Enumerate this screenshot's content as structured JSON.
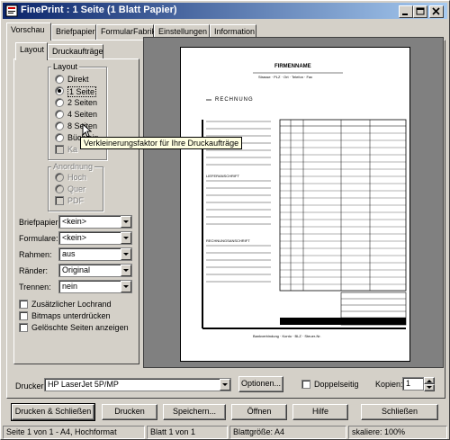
{
  "window": {
    "title": "FinePrint : 1 Seite (1 Blatt Papier)"
  },
  "tabs": [
    "Vorschau",
    "Briefpapier",
    "FormularFabrik",
    "Einstellungen",
    "Information"
  ],
  "subtabs": [
    "Layout",
    "Druckaufträge"
  ],
  "layout_group": {
    "title": "Layout",
    "options": [
      "Direkt",
      "1 Seite",
      "2 Seiten",
      "4 Seiten",
      "8 Seiten",
      "Büchlein"
    ],
    "selected": "1 Seite",
    "checkbox_label": "Ka"
  },
  "tooltip": "Verkleinerungsfaktor für Ihre Druckaufträge",
  "orientation_group": {
    "title": "Anordnung",
    "options": [
      "Hoch",
      "Quer"
    ],
    "checkbox_label": "PDF"
  },
  "fields": [
    {
      "label": "Briefpapier:",
      "value": "<kein>"
    },
    {
      "label": "Formulare:",
      "value": "<kein>"
    },
    {
      "label": "Rahmen:",
      "value": "aus"
    },
    {
      "label": "Ränder:",
      "value": "Original"
    },
    {
      "label": "Trennen:",
      "value": "nein"
    }
  ],
  "checkboxes": [
    "Zusätzlicher Lochrand",
    "Bitmaps unterdrücken",
    "Gelöschte Seiten anzeigen"
  ],
  "printer": {
    "label": "Drucker:",
    "value": "HP LaserJet 5P/MP",
    "options_button": "Optionen...",
    "duplex_label": "Doppelseitig",
    "copies_label": "Kopien:",
    "copies_value": "1"
  },
  "buttons": [
    "Drucken & Schließen",
    "Drucken",
    "Speichern...",
    "Öffnen",
    "Hilfe",
    "Schließen"
  ],
  "statusbar": [
    "Seite 1 von 1 - A4, Hochformat",
    "Blatt 1 von 1",
    "Blattgröße: A4",
    "skaliere: 100%"
  ],
  "document": {
    "company": "FIRMENNAME",
    "subline": "Strasse · PLZ · Ort · Telefon · Fax",
    "heading": "RECHNUNG",
    "section1": "LIEFERANSCHRIFT",
    "section2": "RECHNUNGSANSCHRIFT",
    "footer": "Bankverbindung · Konto · BLZ · Steuer-Nr."
  },
  "colors": {
    "title_start": "#0a246a",
    "title_end": "#a6caf0",
    "face": "#d4d0c8",
    "preview_bg": "#808080"
  }
}
